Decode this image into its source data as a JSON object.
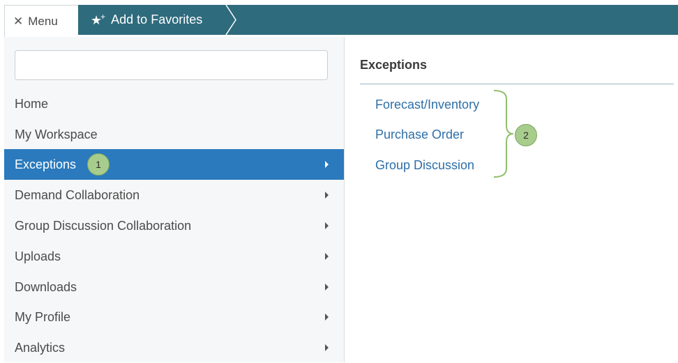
{
  "topbar": {
    "menu_label": "Menu",
    "close_glyph": "✕",
    "favorites_label": "Add to Favorites",
    "favorites_icon": "star-plus-icon",
    "bar_color": "#2e6b7d"
  },
  "search": {
    "value": "",
    "placeholder": ""
  },
  "nav": {
    "items": [
      {
        "label": "Home",
        "has_submenu": false
      },
      {
        "label": "My Workspace",
        "has_submenu": false
      },
      {
        "label": "Exceptions",
        "has_submenu": true,
        "active": true,
        "callout": "1"
      },
      {
        "label": "Demand Collaboration",
        "has_submenu": true
      },
      {
        "label": "Group Discussion Collaboration",
        "has_submenu": true
      },
      {
        "label": "Uploads",
        "has_submenu": true
      },
      {
        "label": "Downloads",
        "has_submenu": true
      },
      {
        "label": "My Profile",
        "has_submenu": true
      },
      {
        "label": "Analytics",
        "has_submenu": true
      }
    ],
    "active_color": "#2a7abd"
  },
  "submenu": {
    "title": "Exceptions",
    "links": [
      {
        "label": "Forecast/Inventory"
      },
      {
        "label": "Purchase Order"
      },
      {
        "label": "Group Discussion"
      }
    ],
    "callout": "2",
    "link_color": "#2d6fa8"
  },
  "callout_color": "#a8cc8c"
}
